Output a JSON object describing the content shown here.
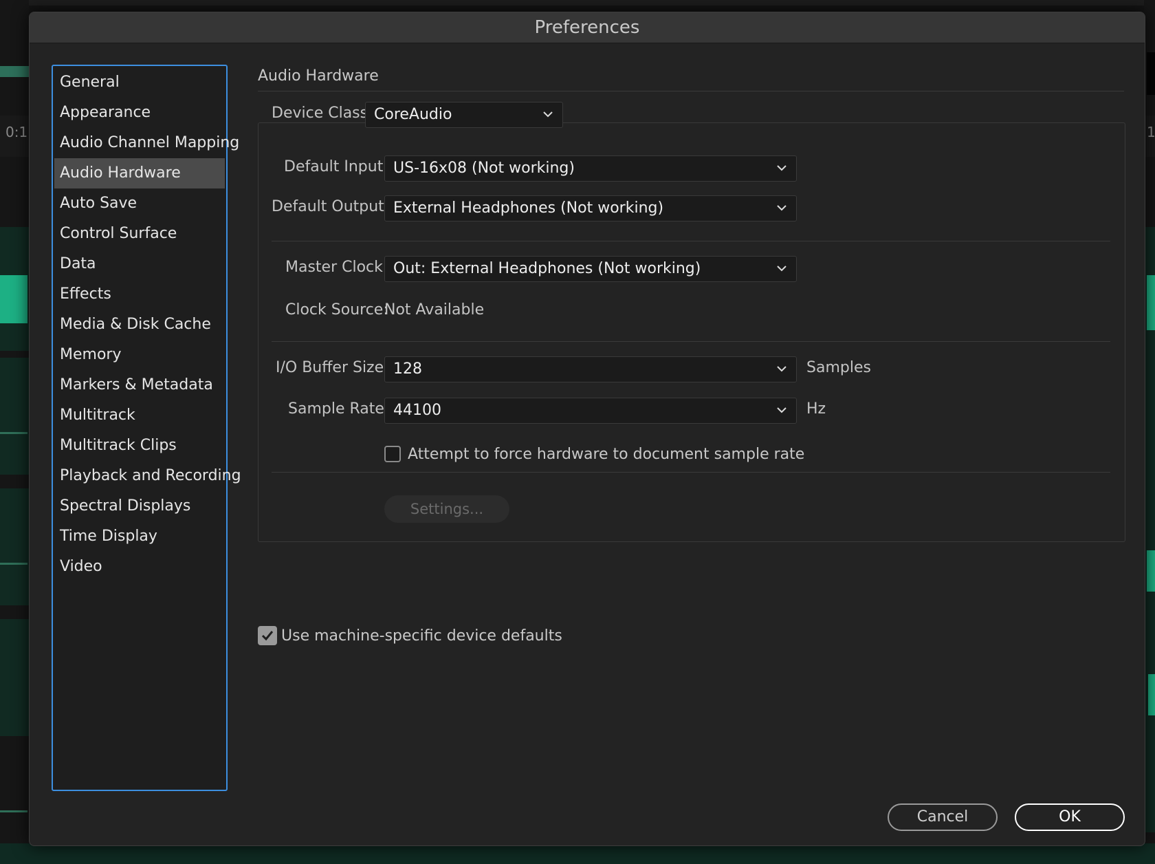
{
  "background": {
    "timecode_left": "0:1",
    "timecode_right": "1"
  },
  "dialog": {
    "title": "Preferences",
    "sidebar": {
      "items": [
        {
          "label": "General"
        },
        {
          "label": "Appearance"
        },
        {
          "label": "Audio Channel Mapping"
        },
        {
          "label": "Audio Hardware",
          "selected": true
        },
        {
          "label": "Auto Save"
        },
        {
          "label": "Control Surface"
        },
        {
          "label": "Data"
        },
        {
          "label": "Effects"
        },
        {
          "label": "Media & Disk Cache"
        },
        {
          "label": "Memory"
        },
        {
          "label": "Markers & Metadata"
        },
        {
          "label": "Multitrack"
        },
        {
          "label": "Multitrack Clips"
        },
        {
          "label": "Playback and Recording"
        },
        {
          "label": "Spectral Displays"
        },
        {
          "label": "Time Display"
        },
        {
          "label": "Video"
        }
      ]
    },
    "panel": {
      "section_title": "Audio Hardware",
      "device_class": {
        "label": "Device Class:",
        "value": "CoreAudio"
      },
      "default_input": {
        "label": "Default Input:",
        "value": "US-16x08 (Not working)"
      },
      "default_output": {
        "label": "Default Output:",
        "value": "External Headphones (Not working)"
      },
      "master_clock": {
        "label": "Master Clock:",
        "value": "Out: External Headphones (Not working)"
      },
      "clock_source": {
        "label": "Clock Source:",
        "value": "Not Available"
      },
      "buffer_size": {
        "label": "I/O Buffer Size:",
        "value": "128",
        "unit": "Samples"
      },
      "sample_rate": {
        "label": "Sample Rate:",
        "value": "44100",
        "unit": "Hz"
      },
      "force_rate": {
        "label": "Attempt to force hardware to document sample rate",
        "checked": false
      },
      "settings_button": "Settings...",
      "machine_defaults": {
        "label": "Use machine-specific device defaults",
        "checked": true
      }
    },
    "buttons": {
      "cancel": "Cancel",
      "ok": "OK"
    },
    "colors": {
      "accent_border": "#3d8fe0",
      "selected_item": "#4b4b4b",
      "dialog_bg": "#232323",
      "waveform": "#1fbf8f"
    }
  }
}
